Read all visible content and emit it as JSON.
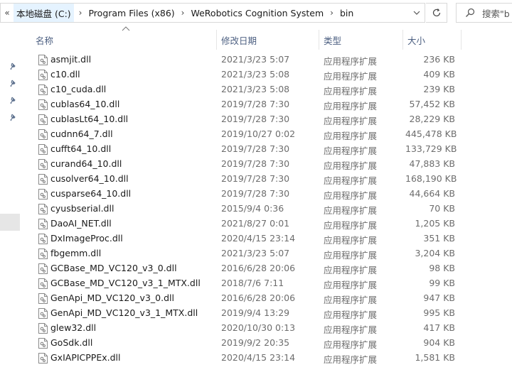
{
  "address": {
    "more": "«",
    "crumbs": [
      "本地磁盘 (C:)",
      "Program Files (x86)",
      "WeRobotics Cognition System",
      "bin"
    ],
    "separator": "›"
  },
  "search": {
    "placeholder": "搜索\"b"
  },
  "columns": {
    "name": "名称",
    "date": "修改日期",
    "type": "类型",
    "size": "大小"
  },
  "files": [
    {
      "name": "asmjit.dll",
      "date": "2021/3/23 5:07",
      "type": "应用程序扩展",
      "size": "236 KB"
    },
    {
      "name": "c10.dll",
      "date": "2021/3/23 5:08",
      "type": "应用程序扩展",
      "size": "409 KB"
    },
    {
      "name": "c10_cuda.dll",
      "date": "2021/3/23 5:08",
      "type": "应用程序扩展",
      "size": "239 KB"
    },
    {
      "name": "cublas64_10.dll",
      "date": "2019/7/28 7:30",
      "type": "应用程序扩展",
      "size": "57,452 KB"
    },
    {
      "name": "cublasLt64_10.dll",
      "date": "2019/7/28 7:30",
      "type": "应用程序扩展",
      "size": "28,229 KB"
    },
    {
      "name": "cudnn64_7.dll",
      "date": "2019/10/27 0:02",
      "type": "应用程序扩展",
      "size": "445,478 KB"
    },
    {
      "name": "cufft64_10.dll",
      "date": "2019/7/28 7:30",
      "type": "应用程序扩展",
      "size": "133,729 KB"
    },
    {
      "name": "curand64_10.dll",
      "date": "2019/7/28 7:30",
      "type": "应用程序扩展",
      "size": "47,883 KB"
    },
    {
      "name": "cusolver64_10.dll",
      "date": "2019/7/28 7:30",
      "type": "应用程序扩展",
      "size": "168,190 KB"
    },
    {
      "name": "cusparse64_10.dll",
      "date": "2019/7/28 7:30",
      "type": "应用程序扩展",
      "size": "44,664 KB"
    },
    {
      "name": "cyusbserial.dll",
      "date": "2015/9/4 0:36",
      "type": "应用程序扩展",
      "size": "70 KB"
    },
    {
      "name": "DaoAI_NET.dll",
      "date": "2021/8/27 0:01",
      "type": "应用程序扩展",
      "size": "1,205 KB"
    },
    {
      "name": "DxImageProc.dll",
      "date": "2020/4/15 23:14",
      "type": "应用程序扩展",
      "size": "351 KB"
    },
    {
      "name": "fbgemm.dll",
      "date": "2021/3/23 5:07",
      "type": "应用程序扩展",
      "size": "3,204 KB"
    },
    {
      "name": "GCBase_MD_VC120_v3_0.dll",
      "date": "2016/6/28 20:06",
      "type": "应用程序扩展",
      "size": "98 KB"
    },
    {
      "name": "GCBase_MD_VC120_v3_1_MTX.dll",
      "date": "2018/7/6 7:11",
      "type": "应用程序扩展",
      "size": "99 KB"
    },
    {
      "name": "GenApi_MD_VC120_v3_0.dll",
      "date": "2016/6/28 20:06",
      "type": "应用程序扩展",
      "size": "947 KB"
    },
    {
      "name": "GenApi_MD_VC120_v3_1_MTX.dll",
      "date": "2019/9/4 13:29",
      "type": "应用程序扩展",
      "size": "995 KB"
    },
    {
      "name": "glew32.dll",
      "date": "2020/10/30 0:13",
      "type": "应用程序扩展",
      "size": "417 KB"
    },
    {
      "name": "GoSdk.dll",
      "date": "2019/9/2 20:35",
      "type": "应用程序扩展",
      "size": "904 KB"
    },
    {
      "name": "GxIAPICPPEx.dll",
      "date": "2020/4/15 23:14",
      "type": "应用程序扩展",
      "size": "1,581 KB"
    }
  ],
  "colors": {
    "header_text": "#4d6082",
    "crumb_highlight": "#e5f3ff",
    "secondary_text": "#6d6d6d"
  }
}
